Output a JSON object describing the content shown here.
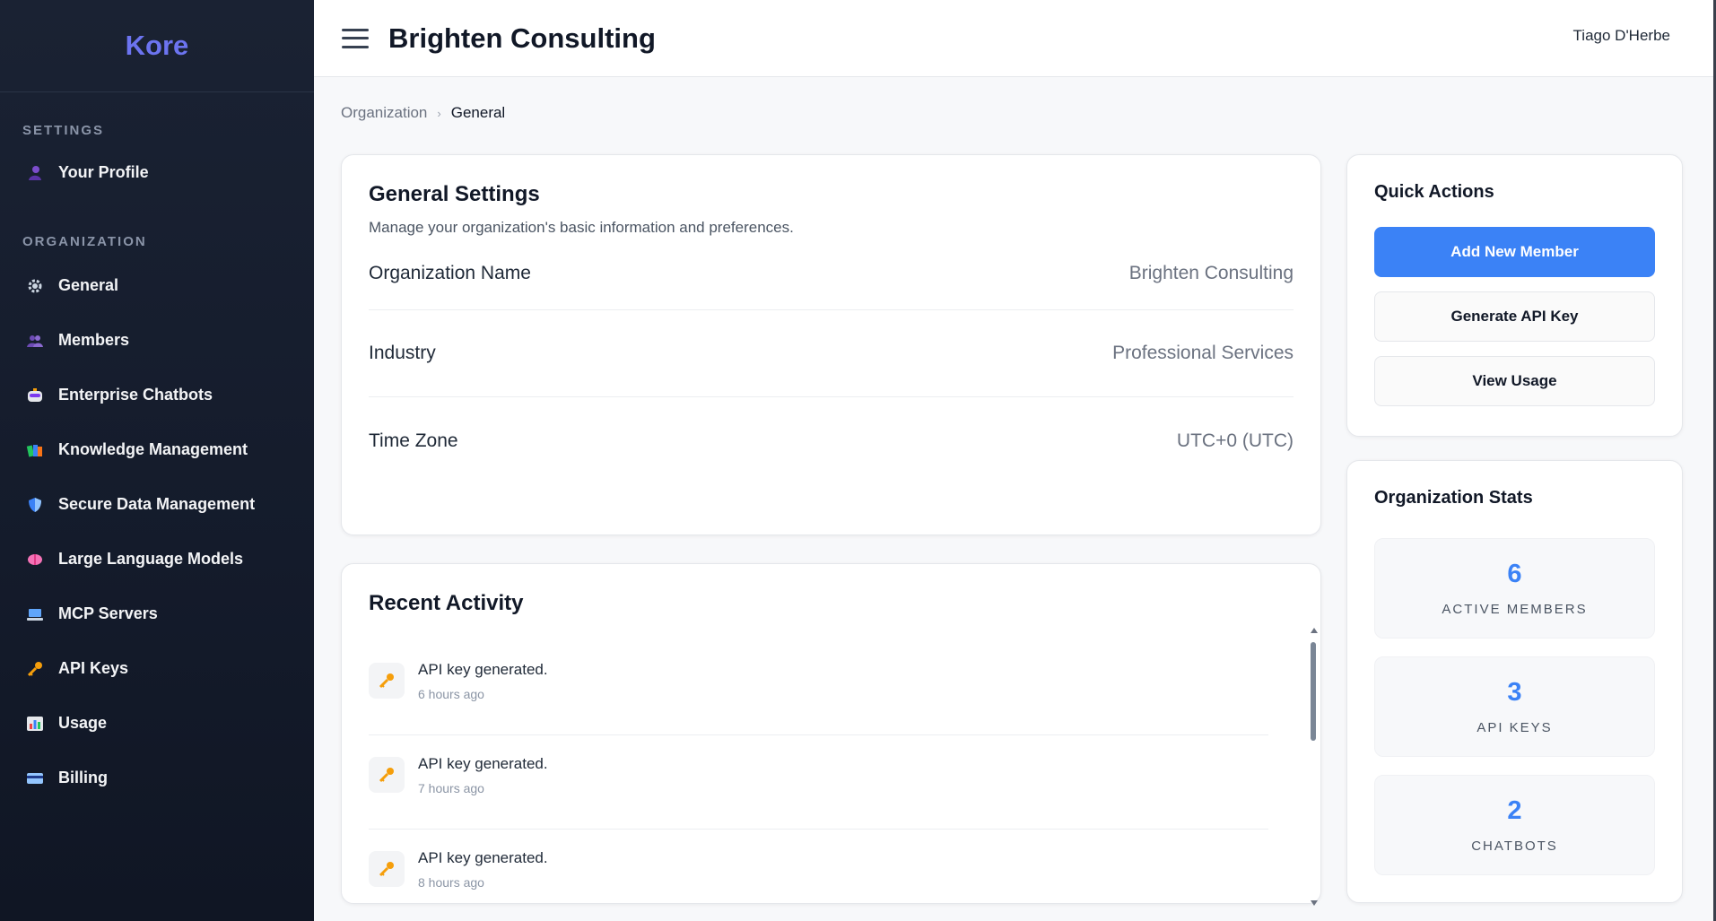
{
  "brand": {
    "name": "Kore"
  },
  "sidebar": {
    "settings_label": "SETTINGS",
    "settings_items": [
      {
        "label": "Your Profile",
        "icon": "person-icon"
      }
    ],
    "organization_label": "ORGANIZATION",
    "organization_items": [
      {
        "label": "General",
        "icon": "gear-icon"
      },
      {
        "label": "Members",
        "icon": "people-icon"
      },
      {
        "label": "Enterprise Chatbots",
        "icon": "robot-icon"
      },
      {
        "label": "Knowledge Management",
        "icon": "books-icon"
      },
      {
        "label": "Secure Data Management",
        "icon": "shield-icon"
      },
      {
        "label": "Large Language Models",
        "icon": "brain-icon"
      },
      {
        "label": "MCP Servers",
        "icon": "computer-icon"
      },
      {
        "label": "API Keys",
        "icon": "key-icon"
      },
      {
        "label": "Usage",
        "icon": "bar-chart-icon"
      },
      {
        "label": "Billing",
        "icon": "credit-card-icon"
      }
    ]
  },
  "header": {
    "title": "Brighten Consulting",
    "user": "Tiago D'Herbe"
  },
  "breadcrumb": {
    "parent": "Organization",
    "current": "General"
  },
  "general_settings": {
    "title": "General Settings",
    "subtitle": "Manage your organization's basic information and preferences.",
    "fields": [
      {
        "label": "Organization Name",
        "value": "Brighten Consulting"
      },
      {
        "label": "Industry",
        "value": "Professional Services"
      },
      {
        "label": "Time Zone",
        "value": "UTC+0 (UTC)"
      }
    ]
  },
  "recent_activity": {
    "title": "Recent Activity",
    "items": [
      {
        "text": "API key generated.",
        "time": "6 hours ago",
        "icon": "key-icon"
      },
      {
        "text": "API key generated.",
        "time": "7 hours ago",
        "icon": "key-icon"
      },
      {
        "text": "API key generated.",
        "time": "8 hours ago",
        "icon": "key-icon"
      }
    ]
  },
  "quick_actions": {
    "title": "Quick Actions",
    "primary": "Add New Member",
    "secondary_1": "Generate API Key",
    "secondary_2": "View Usage"
  },
  "org_stats": {
    "title": "Organization Stats",
    "stats": [
      {
        "value": "6",
        "label": "ACTIVE MEMBERS"
      },
      {
        "value": "3",
        "label": "API KEYS"
      },
      {
        "value": "2",
        "label": "CHATBOTS"
      }
    ]
  },
  "colors": {
    "accent": "#3b82f6",
    "brand": "#6c74f0",
    "sidebar_bg": "#1a2233"
  }
}
